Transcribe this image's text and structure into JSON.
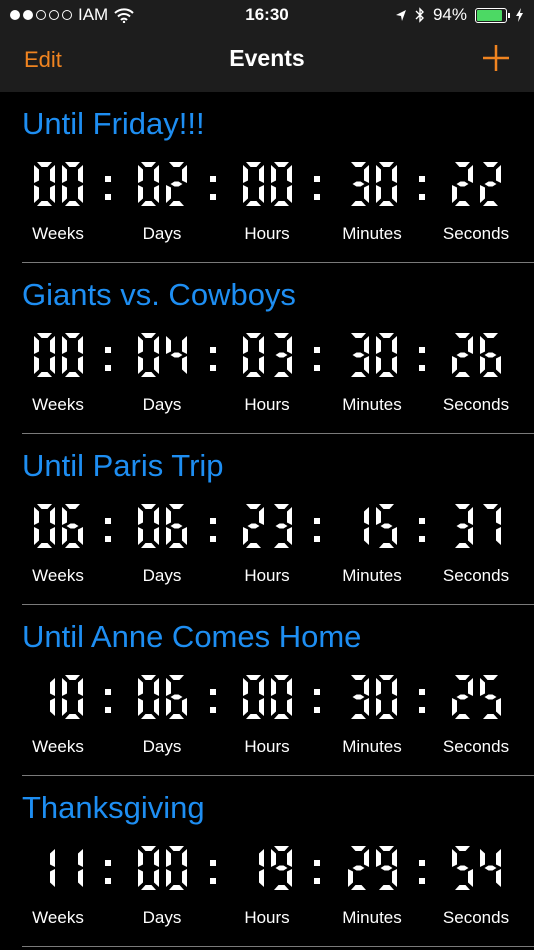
{
  "status_bar": {
    "carrier": "IAM",
    "time": "16:30",
    "battery": "94%",
    "battery_level": 0.94
  },
  "nav": {
    "edit_label": "Edit",
    "title": "Events",
    "add_icon": "plus-icon"
  },
  "units": [
    "Weeks",
    "Days",
    "Hours",
    "Minutes",
    "Seconds"
  ],
  "events": [
    {
      "name": "Until Friday!!!",
      "countdown": [
        "00",
        "02",
        "00",
        "30",
        "22"
      ]
    },
    {
      "name": "Giants vs. Cowboys",
      "countdown": [
        "00",
        "04",
        "03",
        "30",
        "26"
      ]
    },
    {
      "name": "Until Paris Trip",
      "countdown": [
        "06",
        "06",
        "23",
        "15",
        "37"
      ]
    },
    {
      "name": "Until Anne Comes Home",
      "countdown": [
        "10",
        "06",
        "00",
        "30",
        "25"
      ]
    },
    {
      "name": "Thanksgiving",
      "countdown": [
        "11",
        "00",
        "19",
        "29",
        "54"
      ]
    }
  ],
  "colors": {
    "accent_orange": "#f08420",
    "event_blue": "#1e8ef2",
    "bar_background": "#1d1d1d",
    "battery_green": "#4cd964"
  }
}
